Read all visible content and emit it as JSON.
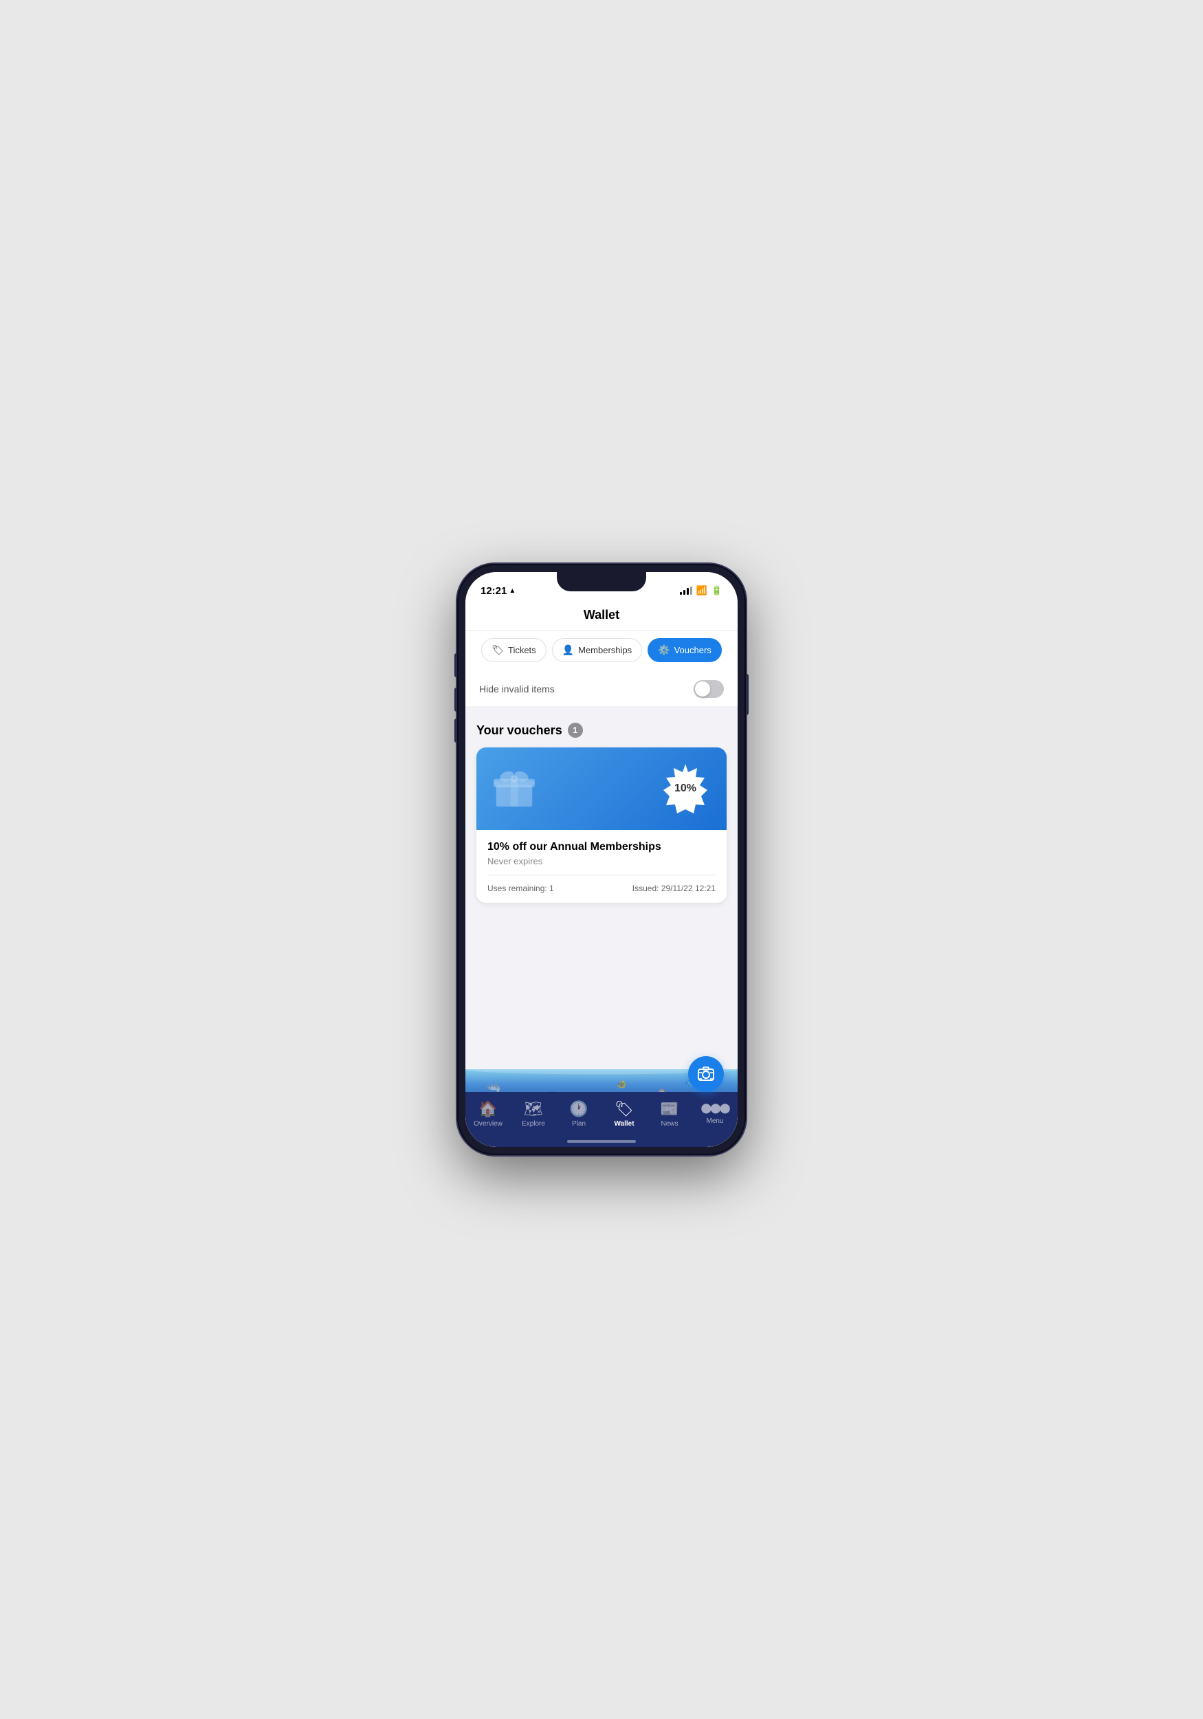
{
  "statusBar": {
    "time": "12:21",
    "arrow": "▶"
  },
  "header": {
    "title": "Wallet"
  },
  "tabs": [
    {
      "id": "tickets",
      "label": "Tickets",
      "icon": "🏷",
      "active": false
    },
    {
      "id": "memberships",
      "label": "Memberships",
      "icon": "👤",
      "active": false
    },
    {
      "id": "vouchers",
      "label": "Vouchers",
      "icon": "⚙️",
      "active": true
    }
  ],
  "toggleRow": {
    "label": "Hide invalid items"
  },
  "vouchersSection": {
    "title": "Your vouchers",
    "count": "1",
    "voucher": {
      "discountPercent": "10%",
      "title": "10% off our Annual Memberships",
      "expires": "Never expires",
      "usesRemaining": "Uses remaining: 1",
      "issued": "Issued: 29/11/22 12:21"
    }
  },
  "bottomNav": [
    {
      "id": "overview",
      "label": "Overview",
      "icon": "🏠",
      "active": false
    },
    {
      "id": "explore",
      "label": "Explore",
      "icon": "🗺",
      "active": false
    },
    {
      "id": "plan",
      "label": "Plan",
      "icon": "🕐",
      "active": false
    },
    {
      "id": "wallet",
      "label": "Wallet",
      "icon": "🏷",
      "active": true
    },
    {
      "id": "news",
      "label": "News",
      "icon": "📰",
      "active": false
    },
    {
      "id": "menu",
      "label": "Menu",
      "icon": "···",
      "active": false
    }
  ]
}
